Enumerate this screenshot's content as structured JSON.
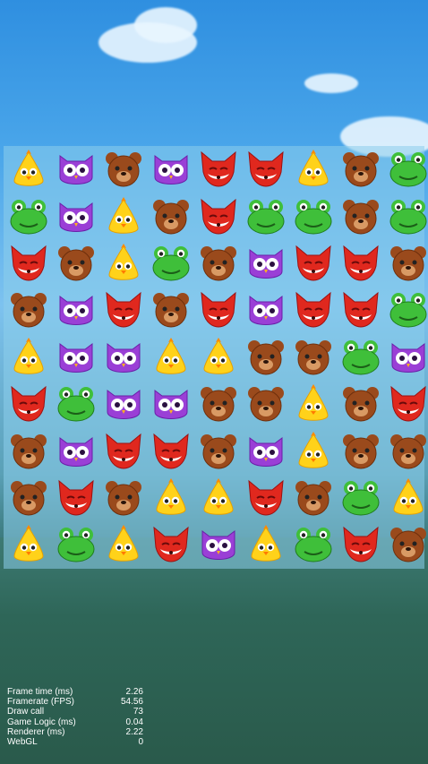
{
  "board": {
    "rows": [
      [
        "chick",
        "owl",
        "bear",
        "owl",
        "fox",
        "fox",
        "chick",
        "bear",
        "frog"
      ],
      [
        "frog",
        "owl",
        "chick",
        "bear",
        "fox",
        "frog",
        "frog",
        "bear",
        "frog"
      ],
      [
        "fox",
        "bear",
        "chick",
        "frog",
        "bear",
        "owl",
        "fox",
        "fox",
        "bear"
      ],
      [
        "bear",
        "owl",
        "fox",
        "bear",
        "fox",
        "owl",
        "fox",
        "fox",
        "frog"
      ],
      [
        "chick",
        "owl",
        "owl",
        "chick",
        "chick",
        "bear",
        "bear",
        "frog",
        "owl"
      ],
      [
        "fox",
        "frog",
        "owl",
        "owl",
        "bear",
        "bear",
        "chick",
        "bear",
        "fox"
      ],
      [
        "bear",
        "owl",
        "fox",
        "fox",
        "bear",
        "owl",
        "chick",
        "bear",
        "bear"
      ],
      [
        "bear",
        "fox",
        "bear",
        "chick",
        "chick",
        "fox",
        "bear",
        "frog",
        "chick"
      ],
      [
        "chick",
        "frog",
        "chick",
        "fox",
        "owl",
        "chick",
        "frog",
        "fox",
        "bear"
      ]
    ]
  },
  "piece_colors": {
    "chick": "#ffd21a",
    "owl": "#9a3fd6",
    "bear": "#9a4a1c",
    "fox": "#e0281e",
    "frog": "#3fbf3a"
  },
  "stats": [
    {
      "label": "Frame time (ms)",
      "value": "2.26"
    },
    {
      "label": "Framerate (FPS)",
      "value": "54.56"
    },
    {
      "label": "Draw call",
      "value": "73"
    },
    {
      "label": "Game Logic (ms)",
      "value": "0.04"
    },
    {
      "label": "Renderer (ms)",
      "value": "2.22"
    },
    {
      "label": "WebGL",
      "value": "0"
    }
  ]
}
